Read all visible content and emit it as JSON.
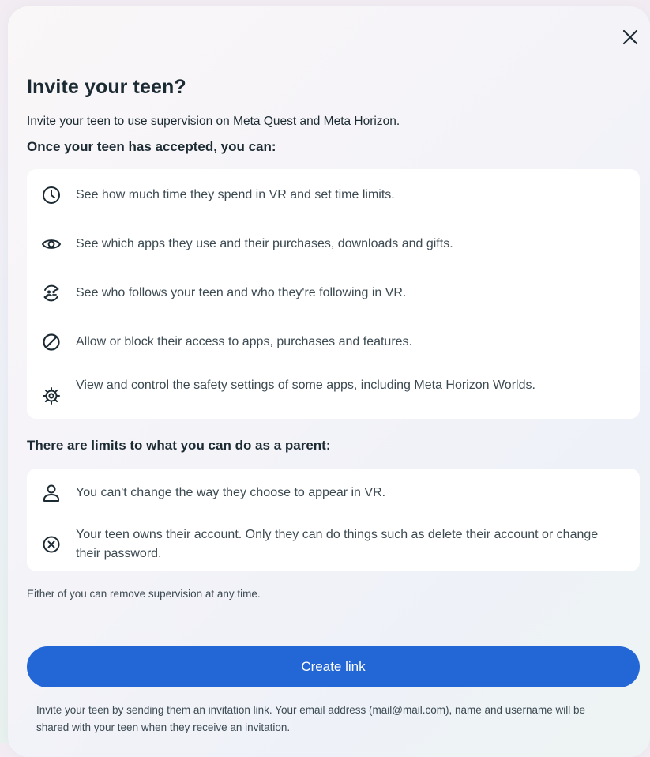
{
  "dialog": {
    "title": "Invite your teen?",
    "subtitle": "Invite your teen to use supervision on Meta Quest and Meta Horizon.",
    "close_icon": "close-icon"
  },
  "accepted_section": {
    "heading": "Once your teen has accepted, you can:",
    "items": [
      {
        "icon": "clock-icon",
        "text": "See how much time they spend in VR and set time limits."
      },
      {
        "icon": "eye-icon",
        "text": "See which apps they use and their purchases, downloads and gifts."
      },
      {
        "icon": "people-sync-icon",
        "text": "See who follows your teen and who they're following in VR."
      },
      {
        "icon": "block-icon",
        "text": "Allow or block their access to apps, purchases and features."
      },
      {
        "icon": "gear-icon",
        "text": "View and control the safety settings of some apps, including Meta Horizon Worlds."
      }
    ]
  },
  "limits_section": {
    "heading": "There are limits to what you can do as a parent:",
    "items": [
      {
        "icon": "person-icon",
        "text": "You can't change the way they choose to appear in VR."
      },
      {
        "icon": "circle-x-icon",
        "text": "Your teen owns their account. Only they can do things such as delete their account or change their password."
      }
    ]
  },
  "note": "Either of you can remove supervision at any time.",
  "create_link_button": "Create link",
  "footer": "Invite your teen by sending them an invitation link. Your email address (mail@mail.com), name and username will be shared with your teen when they receive an invitation.",
  "colors": {
    "primary": "#2366d6",
    "text": "#1c2b33",
    "secondary_text": "#3c4a52",
    "card": "#ffffff"
  }
}
